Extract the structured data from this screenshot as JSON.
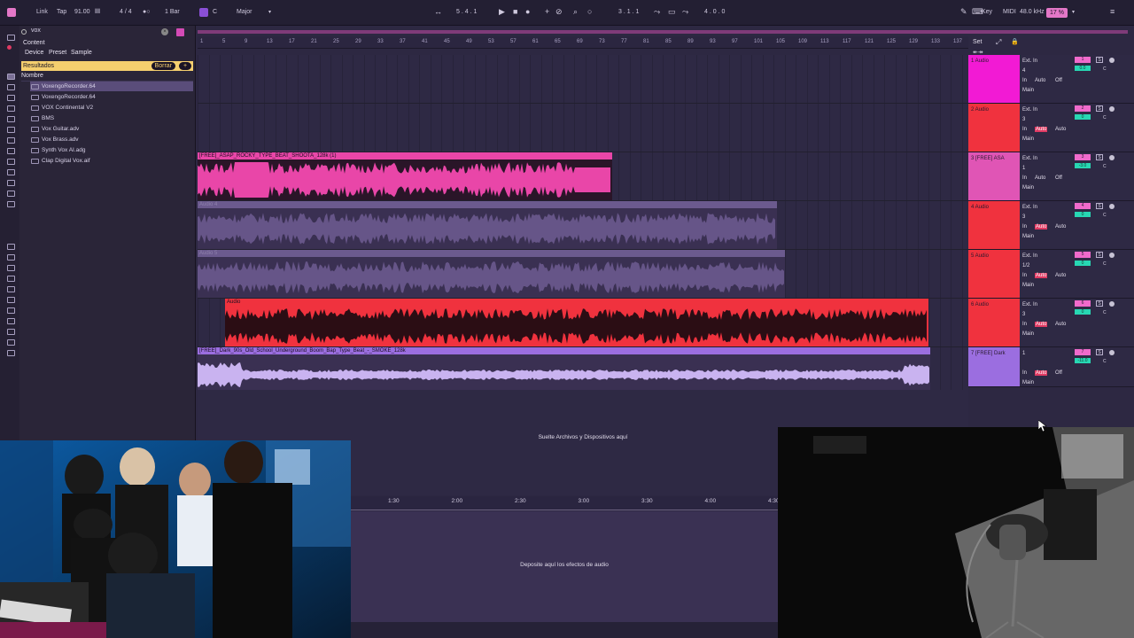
{
  "topbar": {
    "link": "Link",
    "tap": "Tap",
    "tempo": "91.00",
    "time_sig": "4 / 4",
    "metro": "1 Bar",
    "key_root": "C",
    "scale": "Major",
    "position": "5 .   4 .   1",
    "loop_start": "3 .   1 .   1",
    "loop_length": "4 .   0 .   0",
    "key_label": "Key",
    "midi_label": "MIDI",
    "sample_rate": "48.0 kHz",
    "cpu": "17 %"
  },
  "browser": {
    "search": "vox",
    "filters": [
      "Content",
      "Device",
      "Preset",
      "Sample"
    ],
    "results_label": "Resultados",
    "clear_label": "Borrar",
    "add_label": "+",
    "column": "Nombre",
    "files": [
      "VoxengoRecorder.64",
      "VoxengoRecorder.64",
      "VOX Continental V2",
      "BMS",
      "Vox Guitar.adv",
      "Vox Brass.adv",
      "Synth Vox AI.adg",
      "Clap Digital Vox.aif"
    ]
  },
  "ruler": {
    "ticks": [
      "1",
      "5",
      "9",
      "13",
      "17",
      "21",
      "25",
      "29",
      "33",
      "37",
      "41",
      "45",
      "49",
      "53",
      "57",
      "61",
      "65",
      "69",
      "73",
      "77",
      "81",
      "85",
      "89",
      "93",
      "97",
      "101",
      "105",
      "109",
      "113",
      "117",
      "121",
      "125",
      "129",
      "133",
      "137"
    ],
    "set_label": "Set"
  },
  "clips": [
    {
      "title": "[FREE]_ASAP_ROCKY_TYPE_BEAT_SHOOTA_128k (1)",
      "color": "#e946a8"
    },
    {
      "title": "Audio 4",
      "color": "#6b5a8e"
    },
    {
      "title": "Audio 5",
      "color": "#6b5a8e"
    },
    {
      "title": "Audio",
      "color": "#f0323e"
    },
    {
      "title": "[FREE]_Dark_90s_Old_School_Underground_Boom_Bap_Type_Beat_-_SMOKE_128k",
      "color": "#9b6ee0"
    }
  ],
  "tracks": [
    {
      "name": "1 Audio",
      "color": "#f21ad4",
      "input": "Ext. In",
      "channel": "4",
      "mon": "Off",
      "out": "Main",
      "num": "1",
      "vol": "0.0",
      "auto_active": false
    },
    {
      "name": "2 Audio",
      "color": "#f0323e",
      "input": "Ext. In",
      "channel": "3",
      "mon": "Auto",
      "out": "Main",
      "num": "2",
      "vol": "0",
      "auto_active": true
    },
    {
      "name": "3 [FREE] ASA",
      "color": "#e055b5",
      "input": "Ext. In",
      "channel": "1",
      "mon": "Off",
      "out": "Main",
      "num": "3",
      "vol": "-3.0",
      "auto_active": false
    },
    {
      "name": "4 Audio",
      "color": "#f0323e",
      "input": "Ext. In",
      "channel": "3",
      "mon": "Auto",
      "out": "Main",
      "num": "4",
      "vol": "0",
      "auto_active": true
    },
    {
      "name": "5 Audio",
      "color": "#f0323e",
      "input": "Ext. In",
      "channel": "1/2",
      "mon": "Auto",
      "out": "Main",
      "num": "5",
      "vol": "0",
      "auto_active": true
    },
    {
      "name": "6 Audio",
      "color": "#f0323e",
      "input": "Ext. In",
      "channel": "3",
      "mon": "Auto",
      "out": "Main",
      "num": "6",
      "vol": "0",
      "auto_active": true
    },
    {
      "name": "7 [FREE] Dark",
      "color": "#9b6ee0",
      "input": "1",
      "channel": "",
      "mon": "Off",
      "out": "Main",
      "num": "7",
      "vol": "-11.0",
      "auto_active": true
    }
  ],
  "drop_msg": "Suelte Archivos y Dispositivos aquí",
  "timeline": [
    "1:30",
    "2:00",
    "2:30",
    "3:00",
    "3:30",
    "4:00",
    "4:30"
  ],
  "fx_msg": "Deposite aquí los efectos de audio",
  "labels": {
    "in": "In",
    "s": "S",
    "c": "C"
  }
}
